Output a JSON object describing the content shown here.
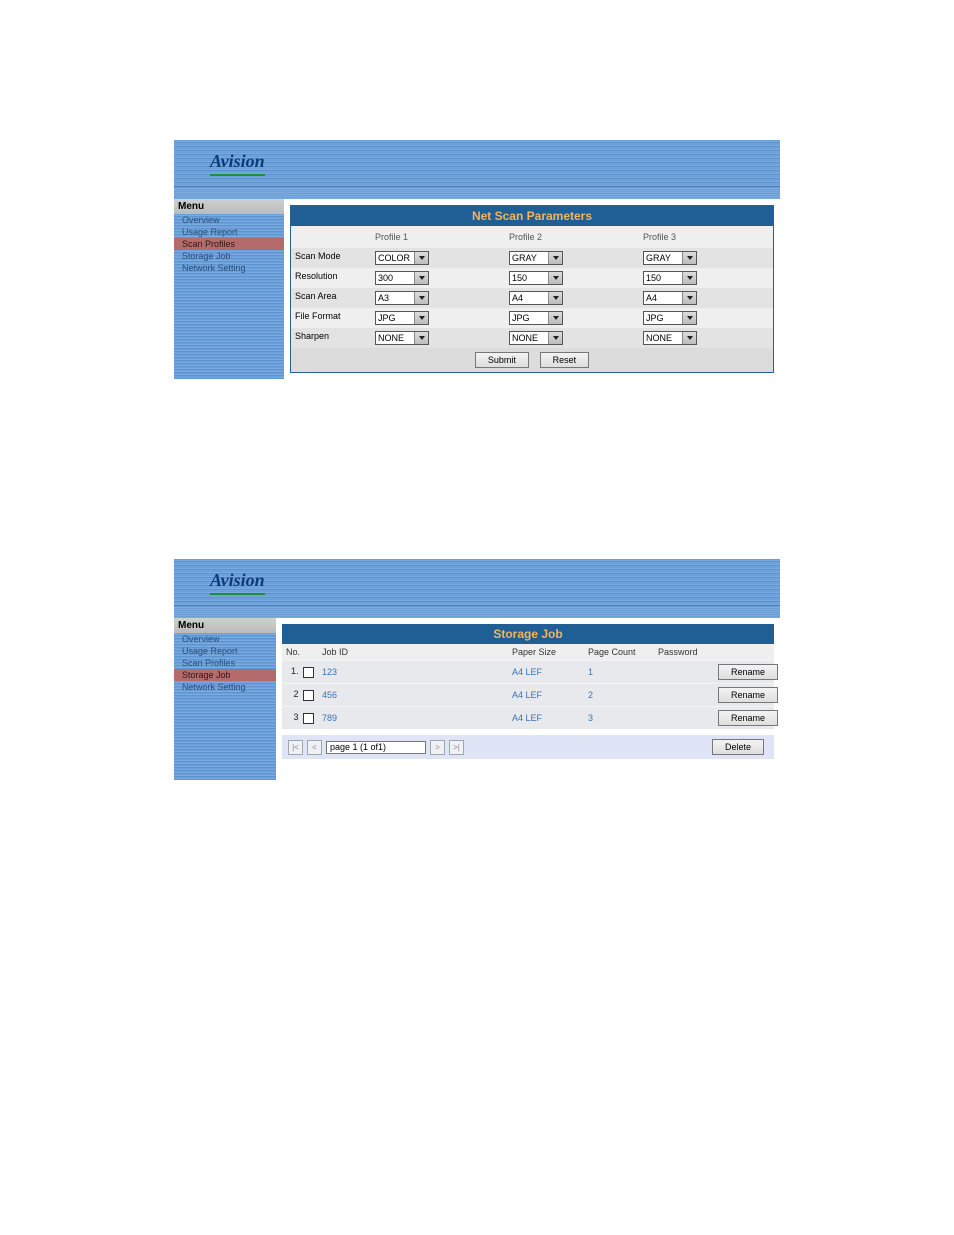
{
  "brand": "Avision",
  "panel1": {
    "menu_header": "Menu",
    "menu": [
      "Overview",
      "Usage Report",
      "Scan Profiles",
      "Storage Job",
      "Network Setting"
    ],
    "active_index": 2,
    "title": "Net Scan Parameters",
    "col_headers": [
      "",
      "Profile 1",
      "Profile 2",
      "Profile 3"
    ],
    "rows": [
      {
        "label": "Scan Mode",
        "values": [
          "COLOR",
          "GRAY",
          "GRAY"
        ]
      },
      {
        "label": "Resolution",
        "values": [
          "300",
          "150",
          "150"
        ]
      },
      {
        "label": "Scan Area",
        "values": [
          "A3",
          "A4",
          "A4"
        ]
      },
      {
        "label": "File Format",
        "values": [
          "JPG",
          "JPG",
          "JPG"
        ]
      },
      {
        "label": "Sharpen",
        "values": [
          "NONE",
          "NONE",
          "NONE"
        ]
      }
    ],
    "submit_label": "Submit",
    "reset_label": "Reset"
  },
  "panel2": {
    "menu_header": "Menu",
    "menu": [
      "Overview",
      "Usage Report",
      "Scan Profiles",
      "Storage Job",
      "Network Setting"
    ],
    "active_index": 3,
    "title": "Storage Job",
    "columns": [
      "No.",
      "Job ID",
      "Paper Size",
      "Page Count",
      "Password",
      ""
    ],
    "jobs": [
      {
        "no": "1.",
        "job_id": "123",
        "paper_size": "A4 LEF",
        "page_count": "1",
        "password": ""
      },
      {
        "no": "2",
        "job_id": "456",
        "paper_size": "A4 LEF",
        "page_count": "2",
        "password": ""
      },
      {
        "no": "3",
        "job_id": "789",
        "paper_size": "A4 LEF",
        "page_count": "3",
        "password": ""
      }
    ],
    "rename_label": "Rename",
    "delete_label": "Delete",
    "pager": {
      "first": "|<",
      "prev": "<",
      "value": "page 1 (1 of1)",
      "next": ">",
      "last": ">|"
    }
  }
}
